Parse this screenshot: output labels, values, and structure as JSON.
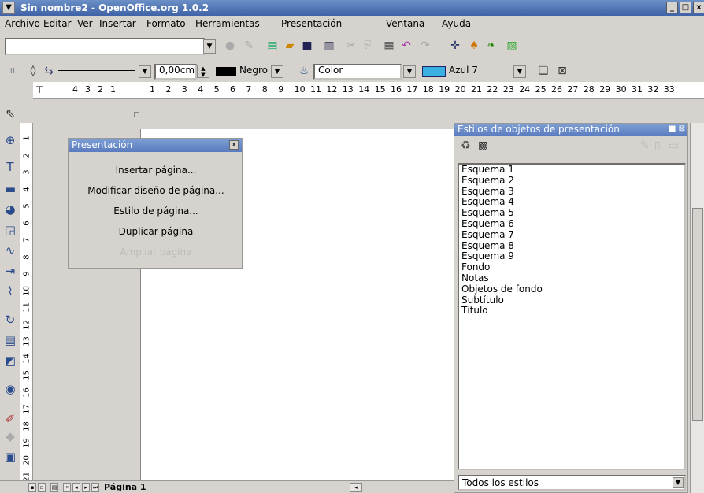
{
  "window": {
    "title": "Sin nombre2 - OpenOffice.org 1.0.2",
    "minimize": "_",
    "maximize": "□",
    "close": "x"
  },
  "menubar": [
    "Archivo",
    "Editar",
    "Ver",
    "Insertar",
    "Formato",
    "Herramientas",
    "Presentación",
    "Ventana",
    "Ayuda"
  ],
  "toolbar2": {
    "line_width": "0,00cm",
    "line_color": "Negro",
    "area_style": "Color",
    "fill_color": "Azul 7"
  },
  "hruler": {
    "left_ticks": [
      "4",
      "3",
      "2",
      "1"
    ],
    "ticks": [
      "1",
      "2",
      "3",
      "4",
      "5",
      "6",
      "7",
      "8",
      "9",
      "10",
      "11",
      "12",
      "13",
      "14",
      "15",
      "16",
      "17",
      "18",
      "19",
      "20",
      "21",
      "22",
      "23",
      "24",
      "25",
      "26",
      "27",
      "28",
      "29",
      "30",
      "31",
      "32",
      "33"
    ]
  },
  "vruler": {
    "ticks": [
      "1",
      "2",
      "3",
      "4",
      "5",
      "6",
      "7",
      "8",
      "9",
      "10",
      "11",
      "12",
      "13",
      "14",
      "15",
      "16",
      "17",
      "18",
      "19",
      "20",
      "21"
    ]
  },
  "popup": {
    "title": "Presentación",
    "items": [
      "Insertar página...",
      "Modificar diseño de página...",
      "Estilo de página...",
      "Duplicar página"
    ],
    "disabled_item": "Ampliar página"
  },
  "stylist": {
    "title": "Estilos de objetos de presentación",
    "styles": [
      "Esquema 1",
      "Esquema 2",
      "Esquema 3",
      "Esquema 4",
      "Esquema 5",
      "Esquema 6",
      "Esquema 7",
      "Esquema 8",
      "Esquema 9",
      "Fondo",
      "Notas",
      "Objetos de fondo",
      "Subtítulo",
      "Título"
    ],
    "filter": "Todos los estilos"
  },
  "bottombar": {
    "tab": "Página 1"
  },
  "colors": {
    "titlebar": "#3f63a6",
    "fill_swatch": "#3ab0e0",
    "line_swatch": "#000000"
  }
}
